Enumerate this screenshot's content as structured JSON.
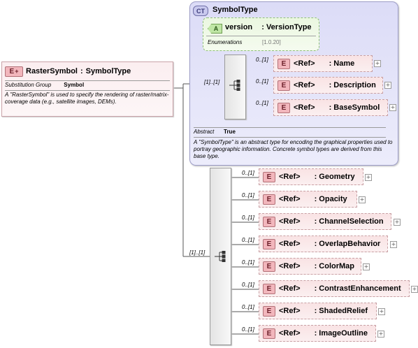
{
  "root": {
    "badge": "E",
    "name": "RasterSymbol",
    "sep": ":",
    "type": "SymbolType",
    "substitution_label": "Substitution Group",
    "substitution_value": "Symbol",
    "documentation": "A \"RasterSymbol\" is used to specify the rendering of raster/matrix-coverage data (e.g., satellite images, DEMs)."
  },
  "complex_type": {
    "badge": "CT",
    "name": "SymbolType",
    "abstract_label": "Abstract",
    "abstract_value": "True",
    "documentation": "A \"SymbolType\" is an abstract type for encoding the graphical properties used to portray geographic information.  Concrete symbol types are derived from this base type."
  },
  "attribute": {
    "badge": "A",
    "name": "version",
    "sep": ":",
    "type": "VersionType",
    "enum_label": "Enumerations",
    "enum_value": "[1.0.20]"
  },
  "type_sequence": {
    "cardinality": "[1]..[1]",
    "elements": [
      {
        "badge": "E",
        "ref": "<Ref>",
        "name": ": Name",
        "cardinality": "0..[1]"
      },
      {
        "badge": "E",
        "ref": "<Ref>",
        "name": ": Description",
        "cardinality": "0..[1]"
      },
      {
        "badge": "E",
        "ref": "<Ref>",
        "name": ": BaseSymbol",
        "cardinality": "0..[1]"
      }
    ]
  },
  "ext_sequence": {
    "cardinality": "[1]..[1]",
    "elements": [
      {
        "badge": "E",
        "ref": "<Ref>",
        "name": ": Geometry",
        "cardinality": "0..[1]"
      },
      {
        "badge": "E",
        "ref": "<Ref>",
        "name": ": Opacity",
        "cardinality": "0..[1]"
      },
      {
        "badge": "E",
        "ref": "<Ref>",
        "name": ": ChannelSelection",
        "cardinality": "0..[1]"
      },
      {
        "badge": "E",
        "ref": "<Ref>",
        "name": ": OverlapBehavior",
        "cardinality": "0..[1]"
      },
      {
        "badge": "E",
        "ref": "<Ref>",
        "name": ": ColorMap",
        "cardinality": "0..[1]"
      },
      {
        "badge": "E",
        "ref": "<Ref>",
        "name": ": ContrastEnhancement",
        "cardinality": "0..[1]"
      },
      {
        "badge": "E",
        "ref": "<Ref>",
        "name": ": ShadedRelief",
        "cardinality": "0..[1]"
      },
      {
        "badge": "E",
        "ref": "<Ref>",
        "name": ": ImageOutline",
        "cardinality": "0..[1]"
      }
    ]
  },
  "expand_glyph": "+",
  "colors": {
    "element_fill": "#f9e3e4",
    "complex_type_fill": "#dcdcf7",
    "attribute_fill": "#eaf7e0"
  }
}
